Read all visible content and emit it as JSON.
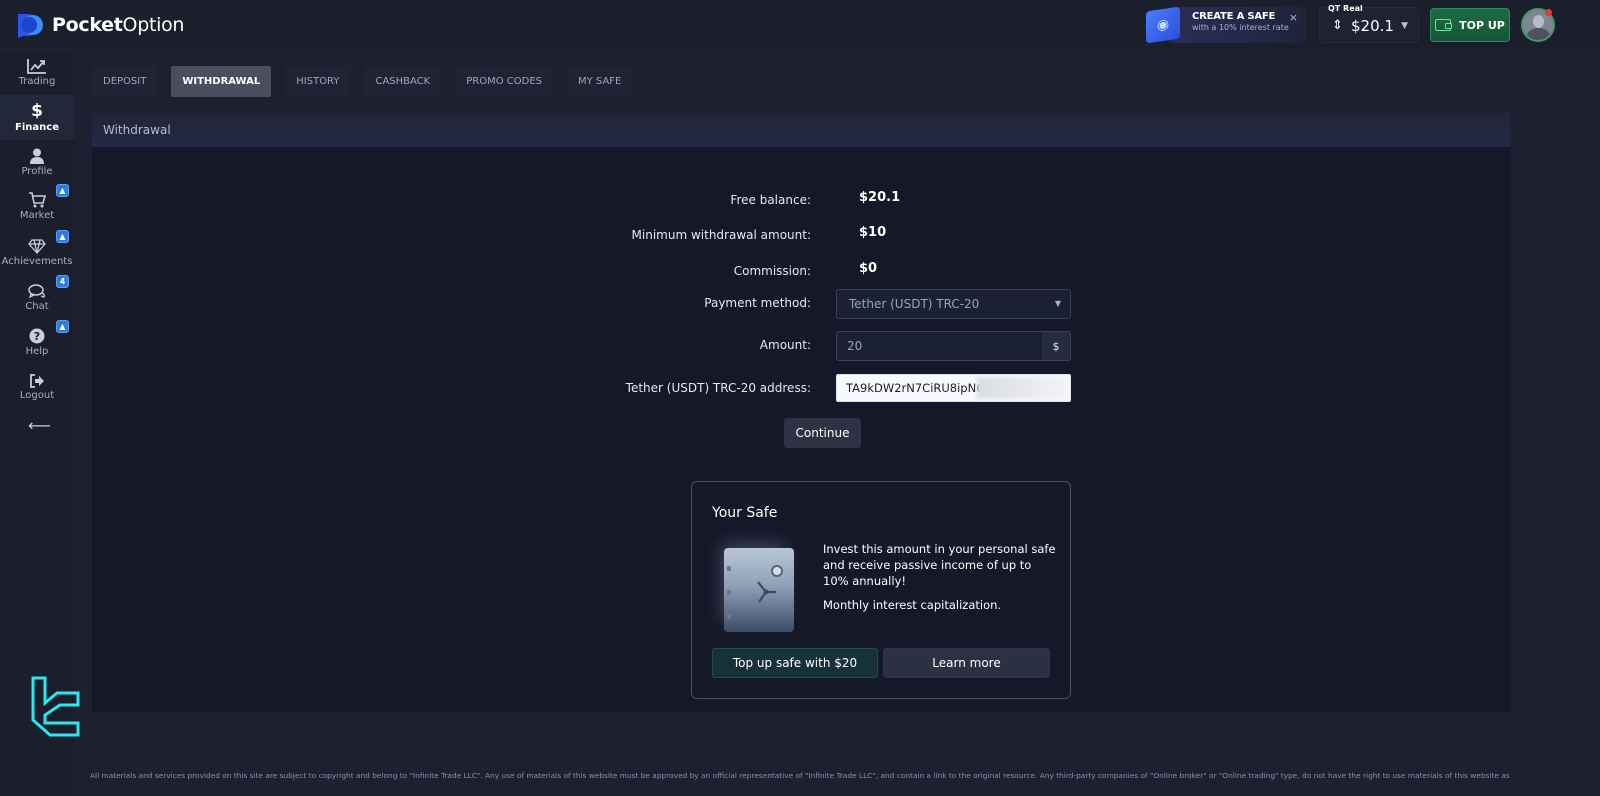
{
  "app": {
    "brand_bold": "Pocket",
    "brand_regular": "Option"
  },
  "header": {
    "promo": {
      "title": "CREATE A SAFE",
      "subtitle": "with a 10% interest rate",
      "close_icon": "×"
    },
    "account": {
      "type_label": "QT Real",
      "balance": "$20.1",
      "currency_icon": "⇕",
      "caret": "▼"
    },
    "topup_label": "TOP UP"
  },
  "sidebar": {
    "items": [
      {
        "label": "Trading",
        "icon": "chart-line-icon",
        "glyph": "📈",
        "active": false,
        "badge": null
      },
      {
        "label": "Finance",
        "icon": "dollar-icon",
        "glyph": "$",
        "active": true,
        "badge": null
      },
      {
        "label": "Profile",
        "icon": "user-icon",
        "glyph": "👤",
        "active": false,
        "badge": null
      },
      {
        "label": "Market",
        "icon": "cart-icon",
        "glyph": "🛒",
        "active": false,
        "badge": "🔔"
      },
      {
        "label": "Achievements",
        "icon": "diamond-icon",
        "glyph": "◇",
        "active": false,
        "badge": "🔔"
      },
      {
        "label": "Chat",
        "icon": "chat-icon",
        "glyph": "💬",
        "active": false,
        "badge": "4"
      },
      {
        "label": "Help",
        "icon": "help-icon",
        "glyph": "?",
        "active": false,
        "badge": "🔔"
      },
      {
        "label": "Logout",
        "icon": "logout-icon",
        "glyph": "⇨",
        "active": false,
        "badge": null
      }
    ],
    "collapse_glyph": "⟵"
  },
  "tabs": [
    {
      "label": "DEPOSIT",
      "active": false
    },
    {
      "label": "WITHDRAWAL",
      "active": true
    },
    {
      "label": "HISTORY",
      "active": false
    },
    {
      "label": "CASHBACK",
      "active": false
    },
    {
      "label": "PROMO CODES",
      "active": false
    },
    {
      "label": "MY SAFE",
      "active": false
    }
  ],
  "panel": {
    "title": "Withdrawal",
    "free_balance_label": "Free balance:",
    "free_balance": "$20.1",
    "min_withdrawal_label": "Minimum withdrawal amount:",
    "min_withdrawal": "$10",
    "commission_label": "Commission:",
    "commission": "$0",
    "payment_method_label": "Payment method:",
    "payment_method": "Tether (USDT) TRC-20",
    "amount_label": "Amount:",
    "amount": "20",
    "amount_currency": "$",
    "address_label": "Tether (USDT) TRC-20 address:",
    "address": "TA9kDW2rN7CiRU8ipN6",
    "continue_label": "Continue"
  },
  "safe_card": {
    "title": "Your Safe",
    "description": "Invest this amount in your personal safe and receive passive income of up to 10% annually!",
    "note": "Monthly interest capitalization.",
    "primary_label": "Top up safe with $20",
    "secondary_label": "Learn more"
  },
  "footer": {
    "text": "All materials and services provided on this site are subject to copyright and belong to \"Infinite Trade LLC\". Any use of materials of this website must be approved by an official representative of \"Infinite Trade LLC\", and contain a link to the original resource. Any third-party companies of \"Online broker\" or \"Online trading\" type, do not have the right to use materials of this website as"
  },
  "colors": {
    "background": "#151828",
    "accent_green": "#1f6b45",
    "accent_blue": "#2f7bde",
    "watermark": "#2ee6f0"
  }
}
